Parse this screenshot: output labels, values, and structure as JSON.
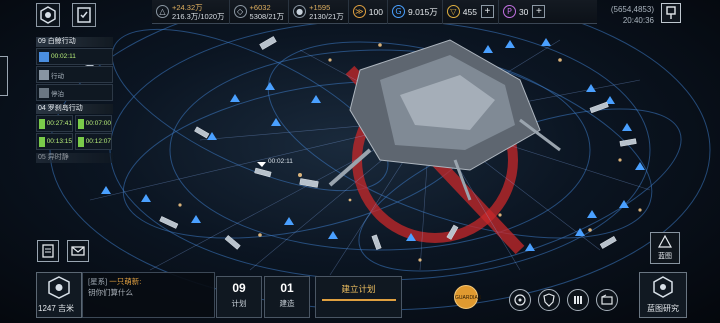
{
  "resources": [
    {
      "icon": "triangle-resource-icon",
      "plus": "+24.32万",
      "total": "216.3万/1020万"
    },
    {
      "icon": "crystal-resource-icon",
      "plus": "+6032",
      "total": "5308/21万"
    },
    {
      "icon": "gas-resource-icon",
      "plus": "+1595",
      "total": "2130/21万"
    }
  ],
  "currency": {
    "energy": "100",
    "credits": "9.015万",
    "gold": "455",
    "premium": "30",
    "plus": "+"
  },
  "coords": {
    "position": "(5654,4853)",
    "time": "20:40:36"
  },
  "fleet": {
    "group1_title": "09 白鲸行动",
    "card1_time": "00:02:11",
    "card1_status": "行动",
    "card2_status": "停泊",
    "group2_title": "04 罗刹岛行动",
    "card3_time": "00:27:41",
    "card4_time": "00:07:00",
    "card5_time": "00:13:15",
    "card6_time": "00:12:07",
    "group3_title": "05 异时静"
  },
  "marker_time": "00:02:11",
  "chat": {
    "channel": "[星系]",
    "sender": "一只萌新:",
    "message": "钥你们算什么"
  },
  "distance": "1247 吉米",
  "bottom": {
    "plan_count": "09",
    "plan_label": "计划",
    "build_count": "01",
    "build_label": "建造",
    "build_plan_title": "建立计划",
    "orange_label": "GUARDIAN",
    "blueprint_label": "蓝图",
    "research_label": "蓝图研究"
  },
  "colors": {
    "accent_orange": "#e0a040",
    "hostile_red": "#c8282a",
    "friendly_blue": "#4aa0ff"
  }
}
